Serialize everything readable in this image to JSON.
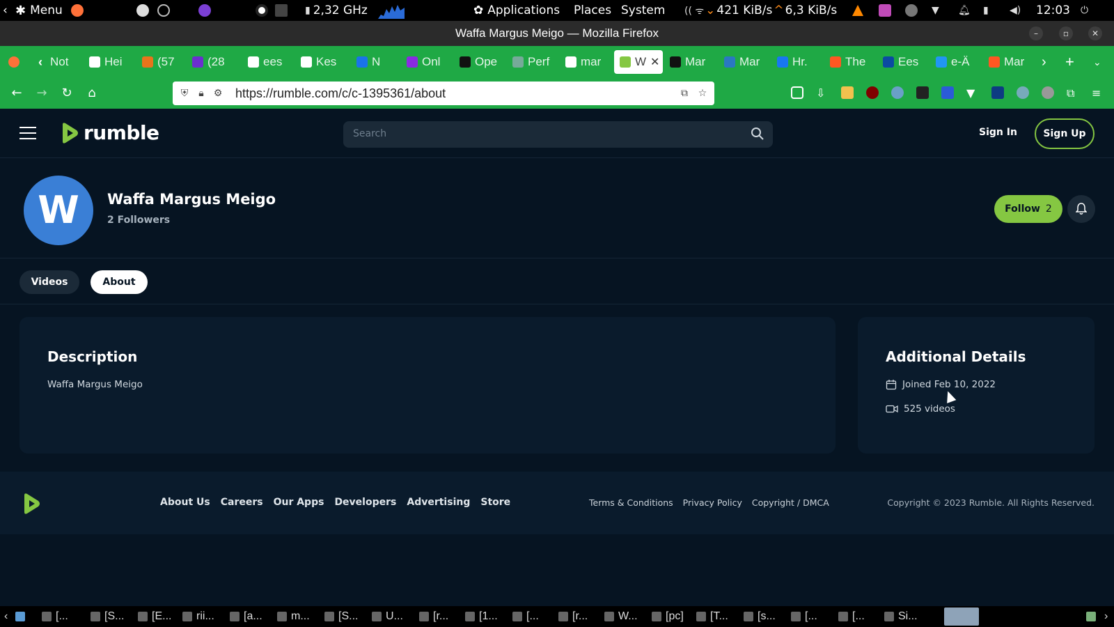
{
  "system_panel": {
    "menu_label": "Menu",
    "cpu_freq": "2,32 GHz",
    "applications": "Applications",
    "places": "Places",
    "system": "System",
    "net_down": "421 KiB/s",
    "net_up": "6,3 KiB/s",
    "clock": "12:03"
  },
  "window": {
    "title": "Waffa Margus Meigo — Mozilla Firefox"
  },
  "tabs": [
    {
      "label": "Not",
      "icon": "back-chevron-icon"
    },
    {
      "label": "Hei",
      "icon": "wikipedia-icon"
    },
    {
      "label": "(57",
      "icon": "fox-icon"
    },
    {
      "label": "(28",
      "icon": "mail-icon"
    },
    {
      "label": "ees",
      "icon": "google-icon"
    },
    {
      "label": "Kes",
      "icon": "sheet-icon"
    },
    {
      "label": "N",
      "icon": "r-icon"
    },
    {
      "label": "Onl",
      "icon": "purple-icon"
    },
    {
      "label": "Ope",
      "icon": "openai-icon"
    },
    {
      "label": "Perf",
      "icon": "gear-icon"
    },
    {
      "label": "mar",
      "icon": "google-icon"
    },
    {
      "label": "W",
      "icon": "rumble-icon",
      "active": true
    },
    {
      "label": "Mar",
      "icon": "tiktok-icon"
    },
    {
      "label": "Mar",
      "icon": "wordpress-icon"
    },
    {
      "label": "Hr.",
      "icon": "facebook-icon"
    },
    {
      "label": "The",
      "icon": "blogger-icon"
    },
    {
      "label": "Ees",
      "icon": "err-icon"
    },
    {
      "label": "e-Ä",
      "icon": "puzzle-icon"
    },
    {
      "label": "Mar",
      "icon": "blogger-icon"
    }
  ],
  "nav": {
    "url": "https://rumble.com/c/c-1395361/about"
  },
  "rumble": {
    "logo_text": "rumble",
    "search_placeholder": "Search",
    "sign_in": "Sign In",
    "sign_up": "Sign Up"
  },
  "channel": {
    "avatar_letter": "W",
    "name": "Waffa Margus Meigo",
    "followers": "2 Followers",
    "follow_label": "Follow",
    "follow_count": "2"
  },
  "channel_tabs": {
    "videos": "Videos",
    "about": "About"
  },
  "description": {
    "heading": "Description",
    "text": "Waffa Margus Meigo"
  },
  "details": {
    "heading": "Additional Details",
    "joined": "Joined Feb 10, 2022",
    "videos": "525 videos"
  },
  "footer": {
    "links": [
      "About Us",
      "Careers",
      "Our Apps",
      "Developers",
      "Advertising",
      "Store"
    ],
    "legal": [
      "Terms & Conditions",
      "Privacy Policy",
      "Copyright / DMCA"
    ],
    "copyright": "Copyright © 2023 Rumble. All Rights Reserved."
  },
  "taskbar": {
    "items": [
      "[...",
      "[S...",
      "[E...",
      "rii...",
      "[a...",
      "m...",
      "[S...",
      "U...",
      "[r...",
      "[1...",
      "[...",
      "[r...",
      "W...",
      "[pc]",
      "[T...",
      "[s...",
      "[...",
      "[...",
      "Si..."
    ]
  },
  "colors": {
    "brand_green": "#85c742",
    "firefox_green": "#1fa945",
    "page_bg": "#061422"
  }
}
